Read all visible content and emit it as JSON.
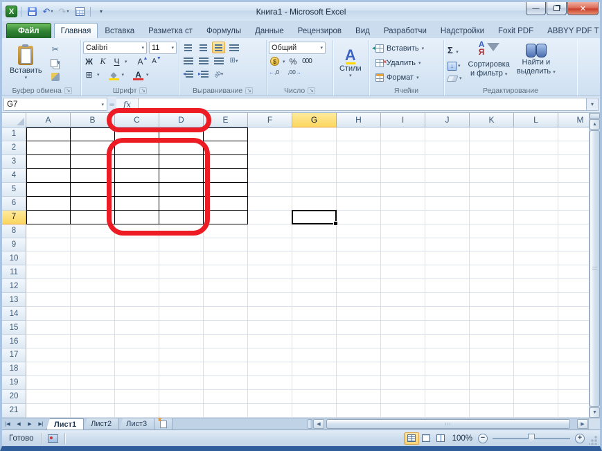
{
  "window": {
    "title": "Книга1  -  Microsoft Excel"
  },
  "colors": {
    "annotation_red": "#ed1c24",
    "header_highlight": "#fbd65f",
    "file_tab_green": "#2e8132",
    "selection_border": "#000000"
  },
  "tabs": [
    {
      "label": "Файл",
      "type": "file"
    },
    {
      "label": "Главная",
      "active": true
    },
    {
      "label": "Вставка"
    },
    {
      "label": "Разметка ст"
    },
    {
      "label": "Формулы"
    },
    {
      "label": "Данные"
    },
    {
      "label": "Рецензиров"
    },
    {
      "label": "Вид"
    },
    {
      "label": "Разработчи"
    },
    {
      "label": "Надстройки"
    },
    {
      "label": "Foxit PDF"
    },
    {
      "label": "ABBYY PDF T"
    }
  ],
  "ribbon": {
    "clipboard": {
      "group_label": "Буфер обмена",
      "paste_label": "Вставить"
    },
    "font": {
      "group_label": "Шрифт",
      "family": "Calibri",
      "size": "11",
      "bold": "Ж",
      "italic": "К",
      "underline": "Ч",
      "grow": "А",
      "shrink": "А",
      "font_color_letter": "А"
    },
    "alignment": {
      "group_label": "Выравнивание",
      "orientation": "ab"
    },
    "number": {
      "group_label": "Число",
      "format": "Общий",
      "percent": "%",
      "thousands": "000",
      "inc_decimal": ",0",
      "dec_decimal": ",00"
    },
    "styles": {
      "group_label": "Стили",
      "letter": "А"
    },
    "cells": {
      "group_label": "Ячейки",
      "insert": "Вставить",
      "delete": "Удалить",
      "format": "Формат"
    },
    "editing": {
      "group_label": "Редактирование",
      "autosum": "Σ",
      "sort_line1": "Сортировка",
      "sort_line2": "и фильтр",
      "find_line1": "Найти и",
      "find_line2": "выделить",
      "az_top": "А",
      "az_bottom": "Я"
    }
  },
  "formula_bar": {
    "name_box": "G7",
    "fx": "fx"
  },
  "grid": {
    "columns": [
      "A",
      "B",
      "C",
      "D",
      "E",
      "F",
      "G",
      "H",
      "I",
      "J",
      "K",
      "L",
      "M"
    ],
    "row_numbers": [
      1,
      2,
      3,
      4,
      5,
      6,
      7,
      8,
      9,
      10,
      11,
      12,
      13,
      14,
      15,
      16,
      17,
      18,
      19,
      20,
      21
    ],
    "selected_cell": "G7",
    "highlighted_column": "G",
    "highlighted_row": 7,
    "bordered_range": {
      "first_col": "A",
      "last_col": "E",
      "first_row": 1,
      "last_row": 7
    }
  },
  "annotations": [
    {
      "name": "columns-c-d-circle"
    },
    {
      "name": "cells-c2-d7-circle"
    }
  ],
  "sheet_bar": {
    "sheets": [
      {
        "label": "Лист1",
        "active": true
      },
      {
        "label": "Лист2"
      },
      {
        "label": "Лист3"
      }
    ]
  },
  "status_bar": {
    "ready": "Готово",
    "zoom_level": "100%"
  }
}
